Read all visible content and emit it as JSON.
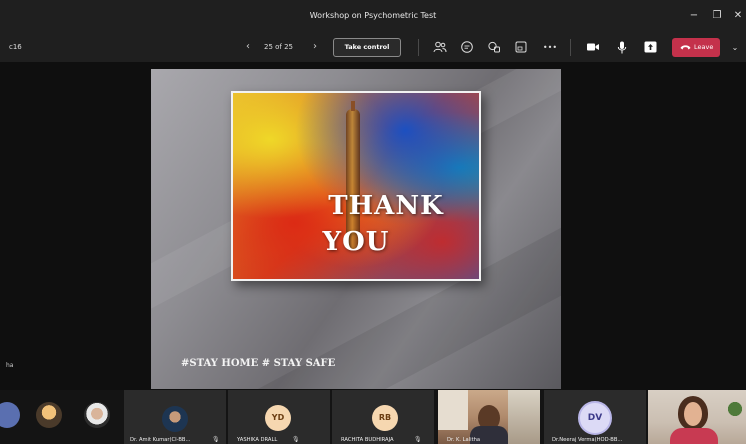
{
  "window": {
    "title": "Workshop on Psychometric Test",
    "minimize": "−",
    "restore": "❐",
    "close": "✕"
  },
  "toolbar": {
    "meeting_fragment": "c16",
    "prev_arrow": "‹",
    "next_arrow": "›",
    "page_indicator": "25 of 25",
    "take_control_label": "Take control",
    "more_label": "•••",
    "leave_label": "Leave",
    "leave_caret": "⌄"
  },
  "slide": {
    "thank_line1": "THANK",
    "thank_line2": "YOU",
    "footer": "#STAY HOME  # STAY SAFE"
  },
  "stage": {
    "corner_fragment": "ha"
  },
  "participants": [
    {
      "name": "Dr. Amit Kumar(CI-BB...",
      "type": "avatar"
    },
    {
      "name": "YASHIKA DRALL",
      "initials": "YD",
      "type": "initials"
    },
    {
      "name": "RACHITA BUDHIRAJA",
      "initials": "RB",
      "type": "initials"
    },
    {
      "name": "Dr. K. Lalitha",
      "type": "video"
    },
    {
      "name": "Dr.Neeraj Verma(HOD-BB...",
      "initials": "DV",
      "type": "ring"
    },
    {
      "name": "",
      "type": "video"
    }
  ],
  "mic_glyph": "🎙",
  "colors": {
    "leave_red": "#c4314b",
    "toolbar_bg": "#1f1f1f",
    "initials_bg": "#f6d7b0",
    "dv_bg": "#dcdaf6"
  }
}
